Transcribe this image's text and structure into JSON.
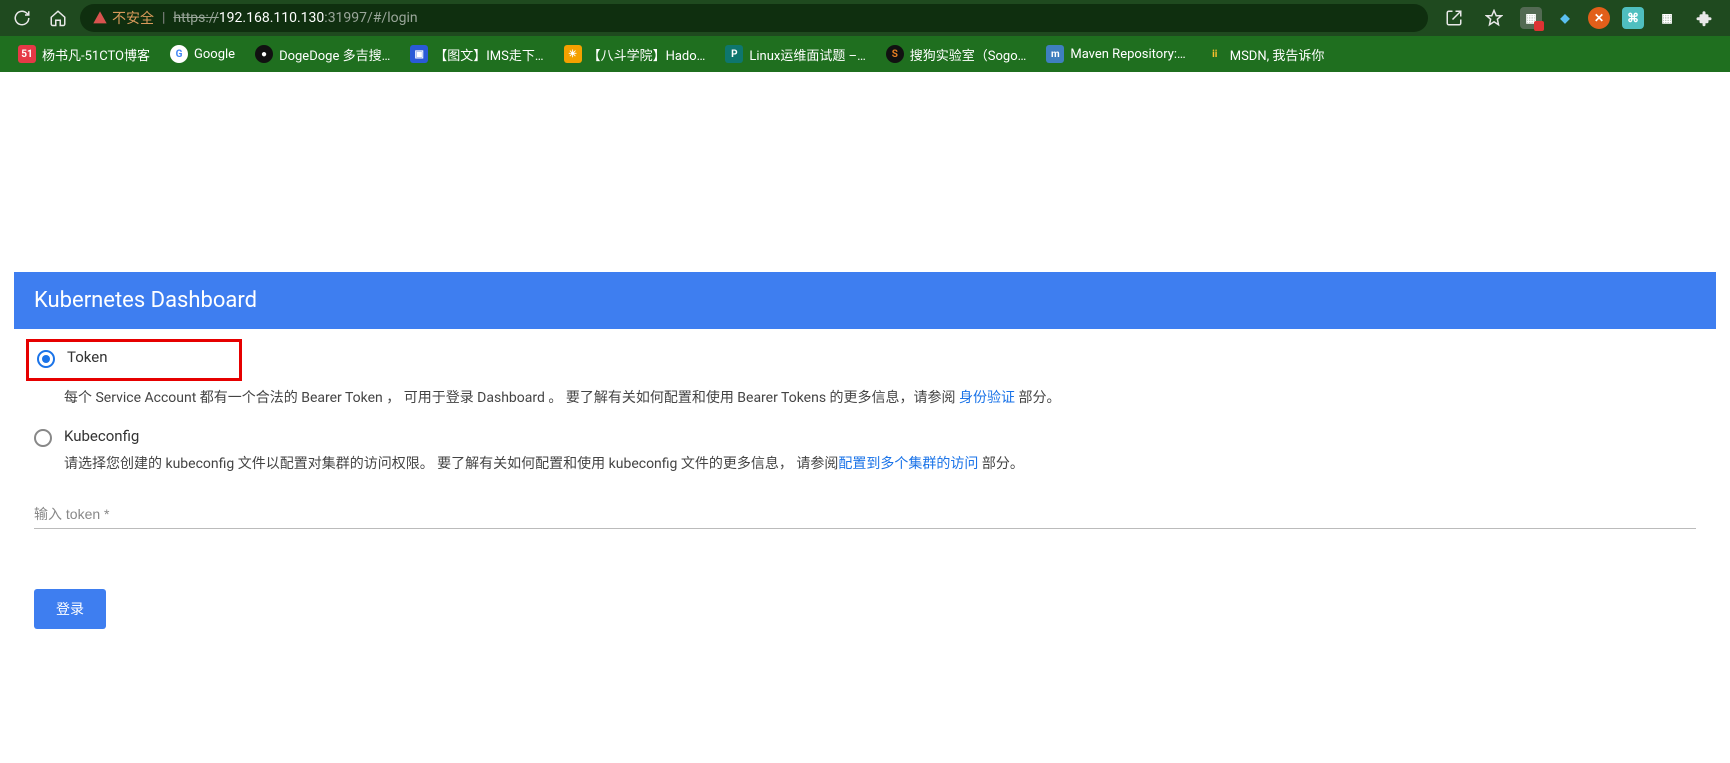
{
  "browser": {
    "insecure_label": "不安全",
    "url_protocol": "https://",
    "url_host_bold": "192.168.110.130",
    "url_rest": ":31997/#/login"
  },
  "bookmarks": [
    {
      "icon": "bm-51",
      "label": "杨书凡-51CTO博客"
    },
    {
      "icon": "bm-g",
      "label": "Google"
    },
    {
      "icon": "bm-dd",
      "label": "DogeDoge 多吉搜…"
    },
    {
      "icon": "bm-bb",
      "label": "【图文】IMS走下…"
    },
    {
      "icon": "bm-sun",
      "label": "【八斗学院】Hado…"
    },
    {
      "icon": "bm-p",
      "label": "Linux运维面试题 –…"
    },
    {
      "icon": "bm-s",
      "label": "搜狗实验室（Sogo…"
    },
    {
      "icon": "bm-mvn",
      "label": "Maven Repository:…"
    },
    {
      "icon": "bm-msdn",
      "label": "MSDN, 我告诉你"
    }
  ],
  "card": {
    "title": "Kubernetes Dashboard",
    "option_token": {
      "label": "Token",
      "desc_before": "每个 Service Account 都有一个合法的 Bearer Token ， 可用于登录 Dashboard 。 要了解有关如何配置和使用 Bearer Tokens 的更多信息，请参阅 ",
      "link": "身份验证",
      "desc_after": " 部分。"
    },
    "option_kubeconfig": {
      "label": "Kubeconfig",
      "desc_before": "请选择您创建的 kubeconfig 文件以配置对集群的访问权限。 要了解有关如何配置和使用 kubeconfig 文件的更多信息， 请参阅",
      "link": "配置到多个集群的访问",
      "desc_after": " 部分。"
    },
    "token_placeholder": "输入 token *",
    "login_label": "登录"
  }
}
